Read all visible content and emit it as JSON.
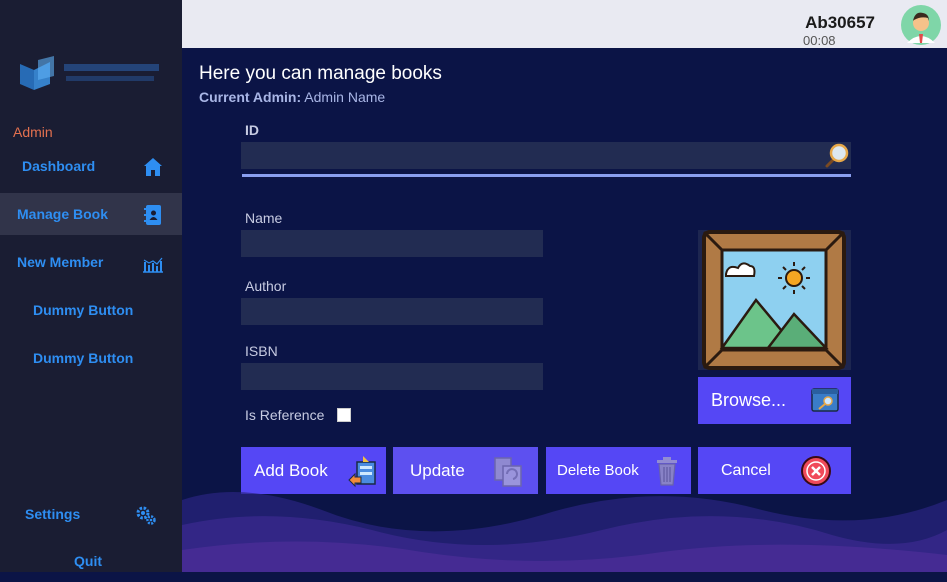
{
  "sidebar": {
    "admin_label": "Admin",
    "items": [
      {
        "label": "Dashboard"
      },
      {
        "label": "Manage Book"
      },
      {
        "label": "New Member"
      },
      {
        "label": "Dummy Button"
      },
      {
        "label": "Dummy Button"
      },
      {
        "label": "Settings"
      },
      {
        "label": "Quit"
      }
    ]
  },
  "header": {
    "user_id": "Ab30657",
    "timer": "00:08"
  },
  "main": {
    "title": "Here you can manage books",
    "current_admin_label": "Current Admin:",
    "current_admin_value": "Admin Name"
  },
  "form": {
    "id_label": "ID",
    "id_value": "",
    "name_label": "Name",
    "name_value": "",
    "author_label": "Author",
    "author_value": "",
    "isbn_label": "ISBN",
    "isbn_value": "",
    "is_reference_label": "Is Reference",
    "is_reference_checked": false
  },
  "buttons": {
    "browse": "Browse...",
    "add": "Add Book",
    "update": "Update",
    "delete": "Delete Book",
    "cancel": "Cancel"
  },
  "colors": {
    "accent": "#5547f5",
    "nav_text": "#2e8ef2",
    "admin_text": "#e3704f",
    "background": "#0b1446",
    "sidebar": "#1a1d33"
  }
}
